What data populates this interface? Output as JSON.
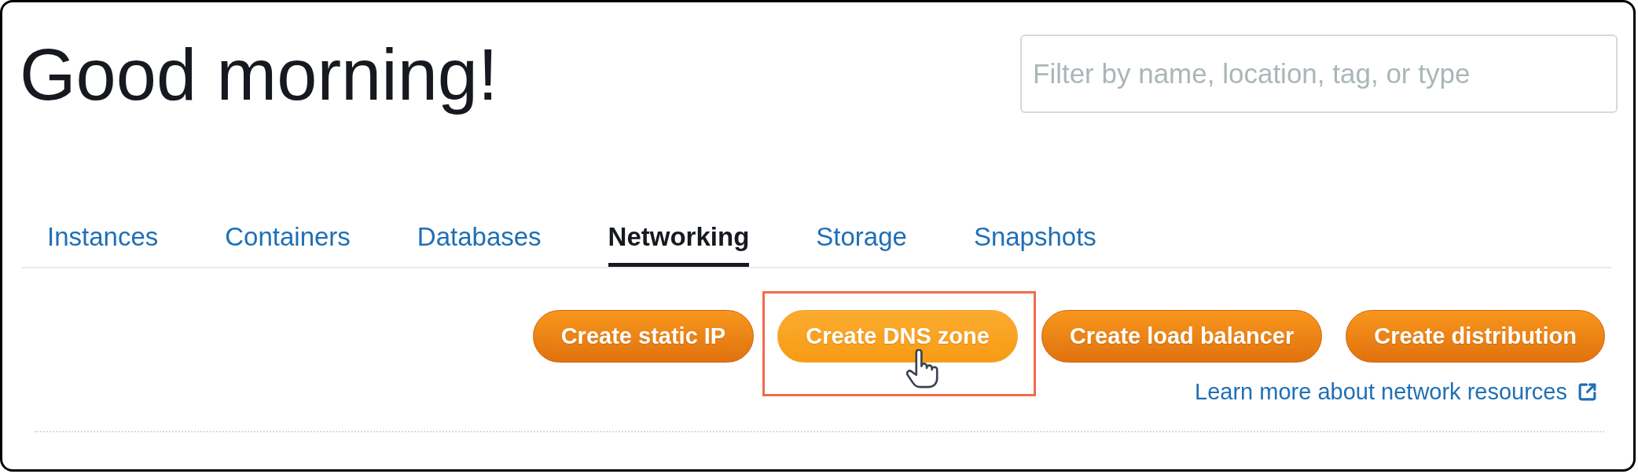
{
  "header": {
    "title": "Good morning!"
  },
  "search": {
    "placeholder": "Filter by name, location, tag, or type"
  },
  "tabs": [
    {
      "label": "Instances",
      "selected": false
    },
    {
      "label": "Containers",
      "selected": false
    },
    {
      "label": "Databases",
      "selected": false
    },
    {
      "label": "Networking",
      "selected": true
    },
    {
      "label": "Storage",
      "selected": false
    },
    {
      "label": "Snapshots",
      "selected": false
    }
  ],
  "actions": [
    {
      "label": "Create static IP",
      "hovered": false,
      "highlighted": false
    },
    {
      "label": "Create DNS zone",
      "hovered": true,
      "highlighted": true
    },
    {
      "label": "Create load balancer",
      "hovered": false,
      "highlighted": false
    },
    {
      "label": "Create distribution",
      "hovered": false,
      "highlighted": false
    }
  ],
  "link": {
    "label": "Learn more about network resources"
  }
}
